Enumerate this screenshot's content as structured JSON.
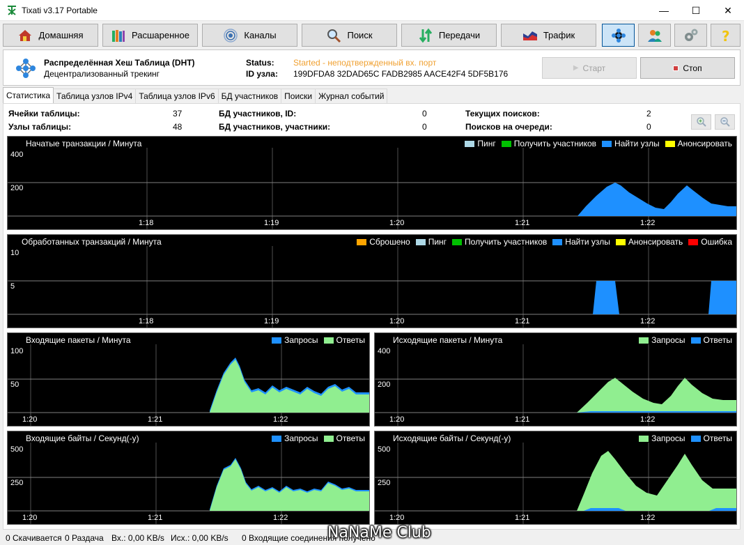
{
  "window": {
    "title": "Tixati v3.17 Portable",
    "minimize": "—",
    "maximize": "☐",
    "close": "✕"
  },
  "toolbar": {
    "home": "Домашняя",
    "shared": "Расшаренное",
    "channels": "Каналы",
    "search": "Поиск",
    "transfers": "Передачи",
    "traffic": "Трафик"
  },
  "dht": {
    "title": "Распределённая Хеш Таблица (DHT)",
    "subtitle": "Децентрализованный трекинг",
    "status_label": "Status:",
    "status_value": "Started - неподтвержденный вх. порт",
    "nodeid_label": "ID узла:",
    "nodeid_value": "199DFDA8 32DAD65C FADB2985 AACE42F4 5DF5B176",
    "start": "Старт",
    "stop": "Стоп"
  },
  "tabs": [
    "Статистика",
    "Таблица узлов IPv4",
    "Таблица узлов IPv6",
    "БД участников",
    "Поиски",
    "Журнал событий"
  ],
  "stats": {
    "cells_label": "Ячейки таблицы:",
    "cells_value": "37",
    "nodes_label": "Узлы таблицы:",
    "nodes_value": "48",
    "peersdb_id_label": "БД участников, ID:",
    "peersdb_id_value": "0",
    "peersdb_peers_label": "БД участников, участники:",
    "peersdb_peers_value": "0",
    "cur_search_label": "Текущих поисков:",
    "cur_search_value": "2",
    "queued_search_label": "Поисков на очереди:",
    "queued_search_value": "0"
  },
  "colors": {
    "ping": "#add8e6",
    "get_peers": "#00c000",
    "find_nodes": "#1e90ff",
    "announce": "#ffff00",
    "dropped": "#ffa500",
    "error": "#ff0000",
    "requests": "#90ee90",
    "status_orange": "#f0a030"
  },
  "graphs": {
    "g1": {
      "title": "Начатые транзакции / Минута",
      "legend": [
        "Пинг",
        "Получить участников",
        "Найти узлы",
        "Анонсировать"
      ],
      "y": [
        "400",
        "200"
      ],
      "x": [
        "1:18",
        "1:19",
        "1:20",
        "1:21",
        "1:22"
      ]
    },
    "g2": {
      "title": "Обработанных транзакций / Минута",
      "legend": [
        "Сброшено",
        "Пинг",
        "Получить участников",
        "Найти узлы",
        "Анонсировать",
        "Ошибка"
      ],
      "y": [
        "10",
        "5"
      ],
      "x": [
        "1:18",
        "1:19",
        "1:20",
        "1:21",
        "1:22"
      ]
    },
    "g3": {
      "title": "Входящие пакеты / Минута",
      "legend": [
        "Запросы",
        "Ответы"
      ],
      "y": [
        "100",
        "50"
      ],
      "x": [
        "1:20",
        "1:21",
        "1:22"
      ]
    },
    "g4": {
      "title": "Исходящие пакеты / Минута",
      "legend": [
        "Запросы",
        "Ответы"
      ],
      "y": [
        "400",
        "200"
      ],
      "x": [
        "1:20",
        "1:21",
        "1:22"
      ]
    },
    "g5": {
      "title": "Входящие байты / Секунд(-у)",
      "legend": [
        "Запросы",
        "Ответы"
      ],
      "y": [
        "500",
        "250"
      ],
      "x": [
        "1:20",
        "1:21",
        "1:22"
      ]
    },
    "g6": {
      "title": "Исходящие байты / Секунд(-у)",
      "legend": [
        "Запросы",
        "Ответы"
      ],
      "y": [
        "500",
        "250"
      ],
      "x": [
        "1:20",
        "1:21",
        "1:22"
      ]
    }
  },
  "statusbar": {
    "downloading": "0 Скачивается",
    "seeding": "0 Раздача",
    "in_speed": "Вх.: 0,00 KB/s",
    "out_speed": "Исх.: 0,00 KB/s",
    "incoming": "0 Входящие соединения получено"
  },
  "watermark": "NaNaMe Club"
}
